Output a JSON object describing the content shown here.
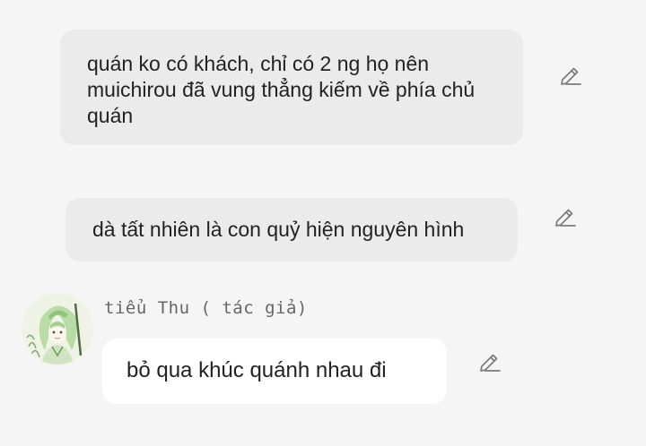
{
  "messages": [
    {
      "text": "quán ko có khách, chỉ có 2 ng họ nên muichirou đã vung thẳng kiếm về phía chủ quán"
    },
    {
      "text": "dà tất nhiên là con quỷ hiện nguyên hình"
    },
    {
      "author": "tiểu Thu ( tác giả)",
      "text": "bỏ qua khúc quánh nhau đi"
    }
  ],
  "icons": {
    "edit": "pencil-edit-icon",
    "avatar": "author-avatar"
  },
  "colors": {
    "background": "#f5f5f5",
    "bubble_grey": "#ebebeb",
    "bubble_white": "#ffffff",
    "text": "#222222",
    "author_text": "#666666"
  }
}
